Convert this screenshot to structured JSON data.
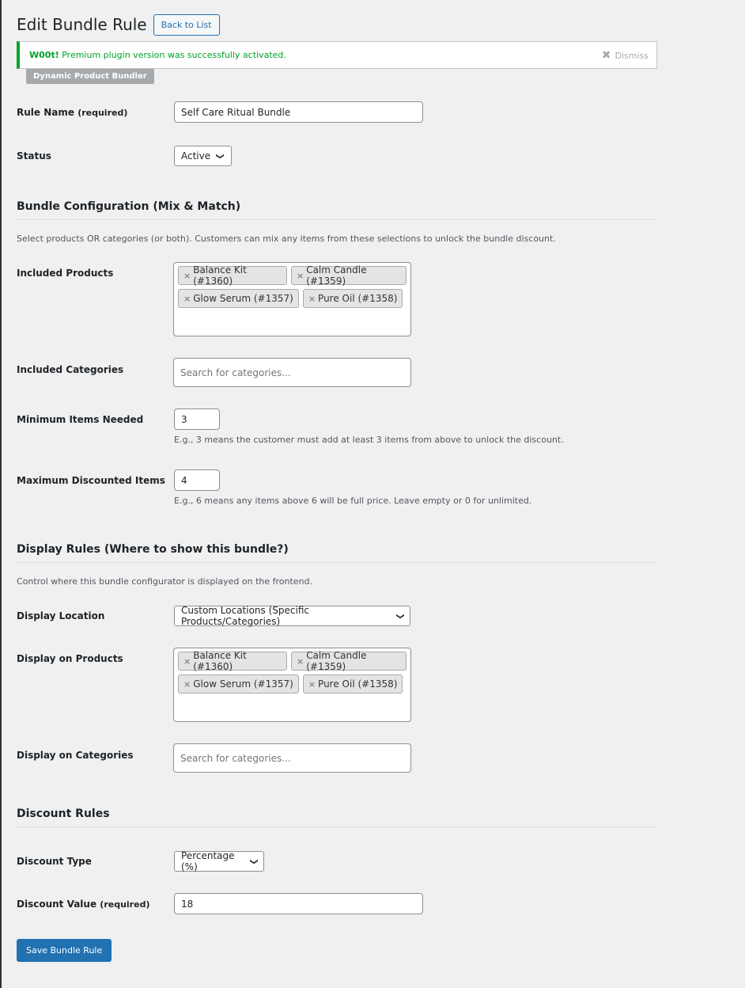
{
  "header": {
    "title": "Edit Bundle Rule",
    "back_label": "Back to List"
  },
  "notice": {
    "strong": "W00t!",
    "message": "Premium plugin version was successfully activated.",
    "dismiss_label": "Dismiss"
  },
  "plugin_tag": "Dynamic Product Bundler",
  "fields": {
    "rule_name": {
      "label": "Rule Name",
      "suffix": "(required)",
      "value": "Self Care Ritual Bundle"
    },
    "status": {
      "label": "Status",
      "value": "Active"
    }
  },
  "bundle_config": {
    "title": "Bundle Configuration (Mix & Match)",
    "description": "Select products OR categories (or both). Customers can mix any items from these selections to unlock the bundle discount.",
    "included_products": {
      "label": "Included Products",
      "chips": [
        "Balance Kit (#1360)",
        "Calm Candle (#1359)",
        "Glow Serum (#1357)",
        "Pure Oil (#1358)"
      ]
    },
    "included_categories": {
      "label": "Included Categories",
      "placeholder": "Search for categories..."
    },
    "min_items": {
      "label": "Minimum Items Needed",
      "value": "3",
      "help": "E.g., 3 means the customer must add at least 3 items from above to unlock the discount."
    },
    "max_items": {
      "label": "Maximum Discounted Items",
      "value": "4",
      "help": "E.g., 6 means any items above 6 will be full price. Leave empty or 0 for unlimited."
    }
  },
  "display_rules": {
    "title": "Display Rules (Where to show this bundle?)",
    "description": "Control where this bundle configurator is displayed on the frontend.",
    "location": {
      "label": "Display Location",
      "value": "Custom Locations (Specific Products/Categories)"
    },
    "products": {
      "label": "Display on Products",
      "chips": [
        "Balance Kit (#1360)",
        "Calm Candle (#1359)",
        "Glow Serum (#1357)",
        "Pure Oil (#1358)"
      ]
    },
    "categories": {
      "label": "Display on Categories",
      "placeholder": "Search for categories..."
    }
  },
  "discount_rules": {
    "title": "Discount Rules",
    "type": {
      "label": "Discount Type",
      "value": "Percentage (%)"
    },
    "value": {
      "label": "Discount Value",
      "suffix": "(required)",
      "value": "18"
    }
  },
  "save_label": "Save Bundle Rule",
  "colors": {
    "primary": "#2271b1",
    "success": "#00a32a",
    "background": "#f0f0f1"
  }
}
